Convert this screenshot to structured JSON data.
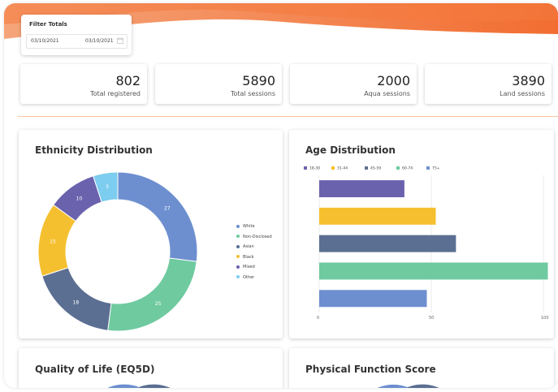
{
  "filter": {
    "title": "Filter Totals",
    "start_date": "03/10/2021",
    "end_date": "03/10/2021"
  },
  "stats": [
    {
      "value": "802",
      "label": "Total registered"
    },
    {
      "value": "5890",
      "label": "Total sessions"
    },
    {
      "value": "2000",
      "label": "Aqua sessions"
    },
    {
      "value": "3890",
      "label": "Land sessions"
    }
  ],
  "colors": {
    "banner_start": "#f08a5a",
    "banner_end": "#f26d31",
    "divider": "#f6c6a6"
  },
  "panels": {
    "ethnicity_title": "Ethnicity Distribution",
    "age_title": "Age Distribution",
    "qol_title": "Quality of Life (EQ5D)",
    "physical_title": "Physical Function Score"
  },
  "chart_data": [
    {
      "type": "pie",
      "title": "Ethnicity Distribution",
      "labels": [
        "White",
        "Non-Disclosed",
        "Asian",
        "Black",
        "Mixed",
        "Other"
      ],
      "values": [
        27,
        25,
        18,
        15,
        10,
        5
      ],
      "colors": [
        "#6d8fd0",
        "#6fcaa0",
        "#5b6f92",
        "#f5c02f",
        "#6b62ae",
        "#7ccdef"
      ],
      "legend": "right"
    },
    {
      "type": "bar",
      "title": "Age Distribution",
      "orientation": "horizontal",
      "categories": [
        "18-30",
        "31-44",
        "45-59",
        "60-74",
        "75+"
      ],
      "values": [
        38,
        52,
        61,
        102,
        48
      ],
      "colors": [
        "#6b62ae",
        "#f5c02f",
        "#5b6f92",
        "#6fcaa0",
        "#6d8fd0"
      ],
      "xticks": [
        "0",
        "50",
        "100"
      ],
      "xlim": [
        0,
        100
      ],
      "legend": "top"
    }
  ]
}
